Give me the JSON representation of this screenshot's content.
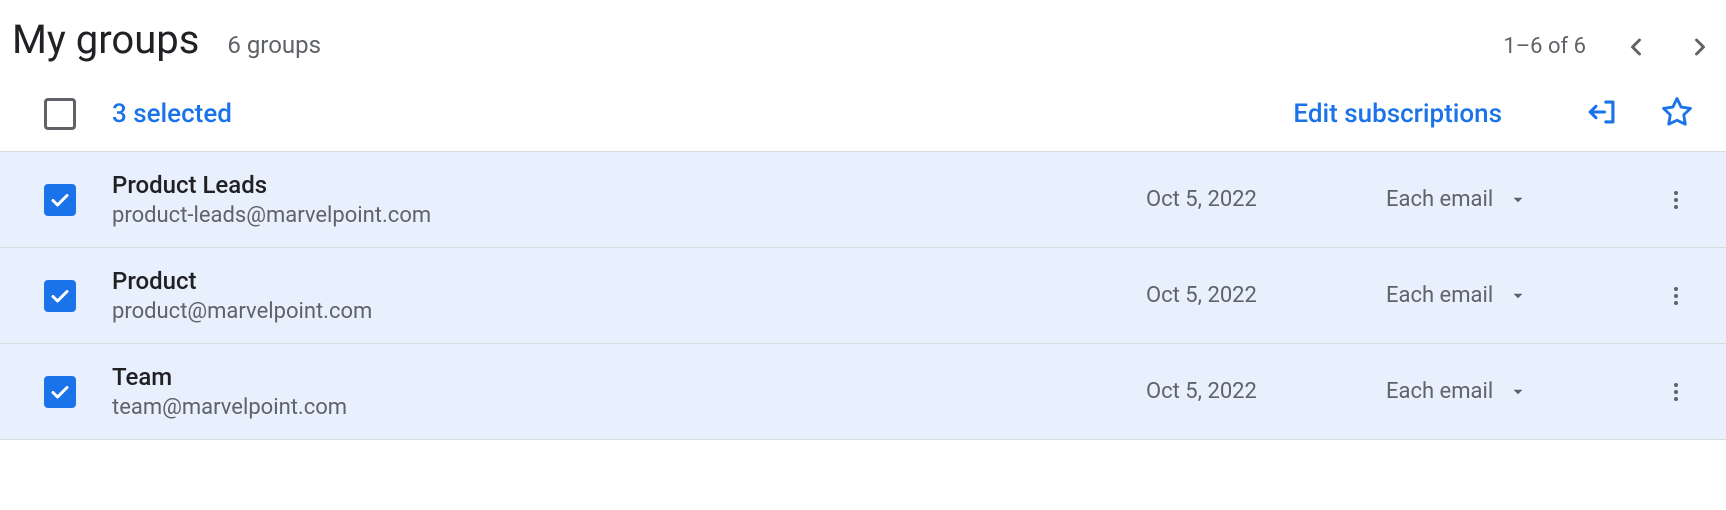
{
  "header": {
    "title": "My groups",
    "count_text": "6 groups",
    "pagination": "1–6 of 6"
  },
  "toolbar": {
    "selected_text": "3 selected",
    "edit_subscriptions": "Edit subscriptions"
  },
  "rows": [
    {
      "name": "Product Leads",
      "email": "product-leads@marvelpoint.com",
      "date": "Oct 5, 2022",
      "subscription": "Each email"
    },
    {
      "name": "Product",
      "email": "product@marvelpoint.com",
      "date": "Oct 5, 2022",
      "subscription": "Each email"
    },
    {
      "name": "Team",
      "email": "team@marvelpoint.com",
      "date": "Oct 5, 2022",
      "subscription": "Each email"
    }
  ]
}
